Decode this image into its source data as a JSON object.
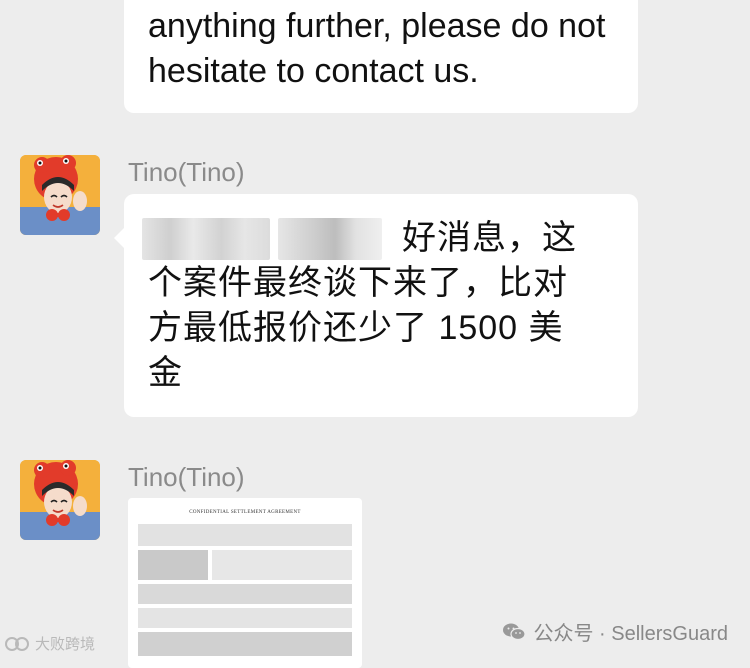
{
  "messages": [
    {
      "text": "anything further, please do not hesitate to contact us."
    },
    {
      "sender": "Tino(Tino)",
      "lines": [
        "好消息，这",
        "个案件最终谈下来了，比对",
        "方最低报价还少了 1500 美",
        "金"
      ]
    },
    {
      "sender": "Tino(Tino)",
      "attachment_title": "CONFIDENTIAL SETTLEMENT AGREEMENT"
    }
  ],
  "watermarks": {
    "left": "大败跨境",
    "right": "公众号 · SellersGuard"
  },
  "colors": {
    "background": "#ededed",
    "bubble": "#ffffff",
    "sender_text": "#8a8a8a"
  }
}
